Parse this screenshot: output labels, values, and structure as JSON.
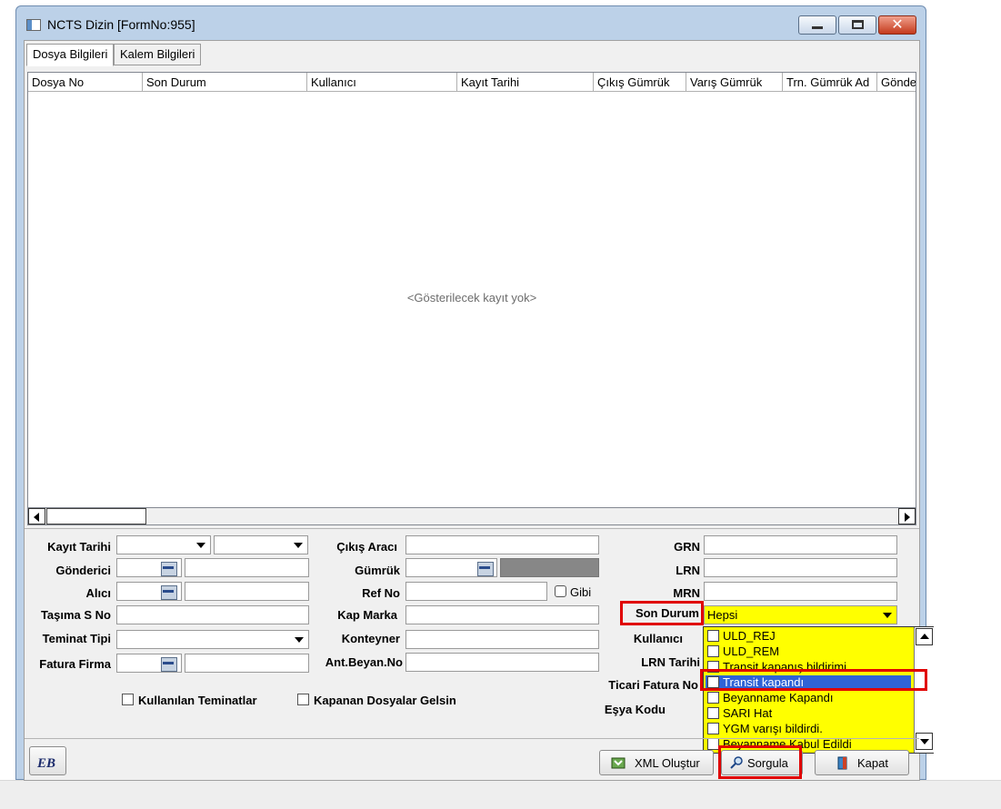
{
  "window": {
    "title": "NCTS Dizin [FormNo:955]"
  },
  "tabs": [
    "Dosya Bilgileri",
    "Kalem Bilgileri"
  ],
  "grid": {
    "columns": [
      "Dosya No",
      "Son Durum",
      "Kullanıcı",
      "Kayıt Tarihi",
      "Çıkış Gümrük",
      "Varış Gümrük",
      "Trn. Gümrük Ad",
      "Gönde"
    ],
    "empty_message": "<Gösterilecek kayıt yok>"
  },
  "filters": {
    "kayit_tarihi": "Kayıt Tarihi",
    "gonderici": "Gönderici",
    "alici": "Alıcı",
    "tasima_s_no": "Taşıma S No",
    "teminat_tipi": "Teminat Tipi",
    "fatura_firma": "Fatura Firma",
    "cikis_araci": "Çıkış Aracı",
    "gumruk": "Gümrük",
    "ref_no": "Ref No",
    "gibi": "Gibi",
    "kap_marka": "Kap Marka",
    "konteyner": "Konteyner",
    "ant_beyan_no": "Ant.Beyan.No",
    "grn": "GRN",
    "lrn": "LRN",
    "mrn": "MRN",
    "son_durum": "Son Durum",
    "son_durum_value": "Hepsi",
    "kullanici": "Kullanıcı",
    "lrn_tarihi": "LRN Tarihi",
    "ticari_fatura_no": "Ticari Fatura No",
    "esya_kodu": "Eşya Kodu",
    "kullanilan_teminatlar": "Kullanılan Teminatlar",
    "kapanan_dosyalar": "Kapanan Dosyalar Gelsin"
  },
  "son_durum_options": [
    "ULD_REJ",
    "ULD_REM",
    "Transit kapanış bildirimi",
    "Transit kapandı",
    "Beyanname Kapandı",
    "SARI Hat",
    "YGM varışı bildirdi.",
    "Beyanname Kabul Edildi"
  ],
  "buttons": {
    "logo": "EB",
    "xml": "XML Oluştur",
    "sorgula": "Sorgula",
    "kapat": "Kapat"
  },
  "colors": {
    "highlight": "#ffff00",
    "annotation": "#e00000",
    "selection": "#2f63d6"
  }
}
